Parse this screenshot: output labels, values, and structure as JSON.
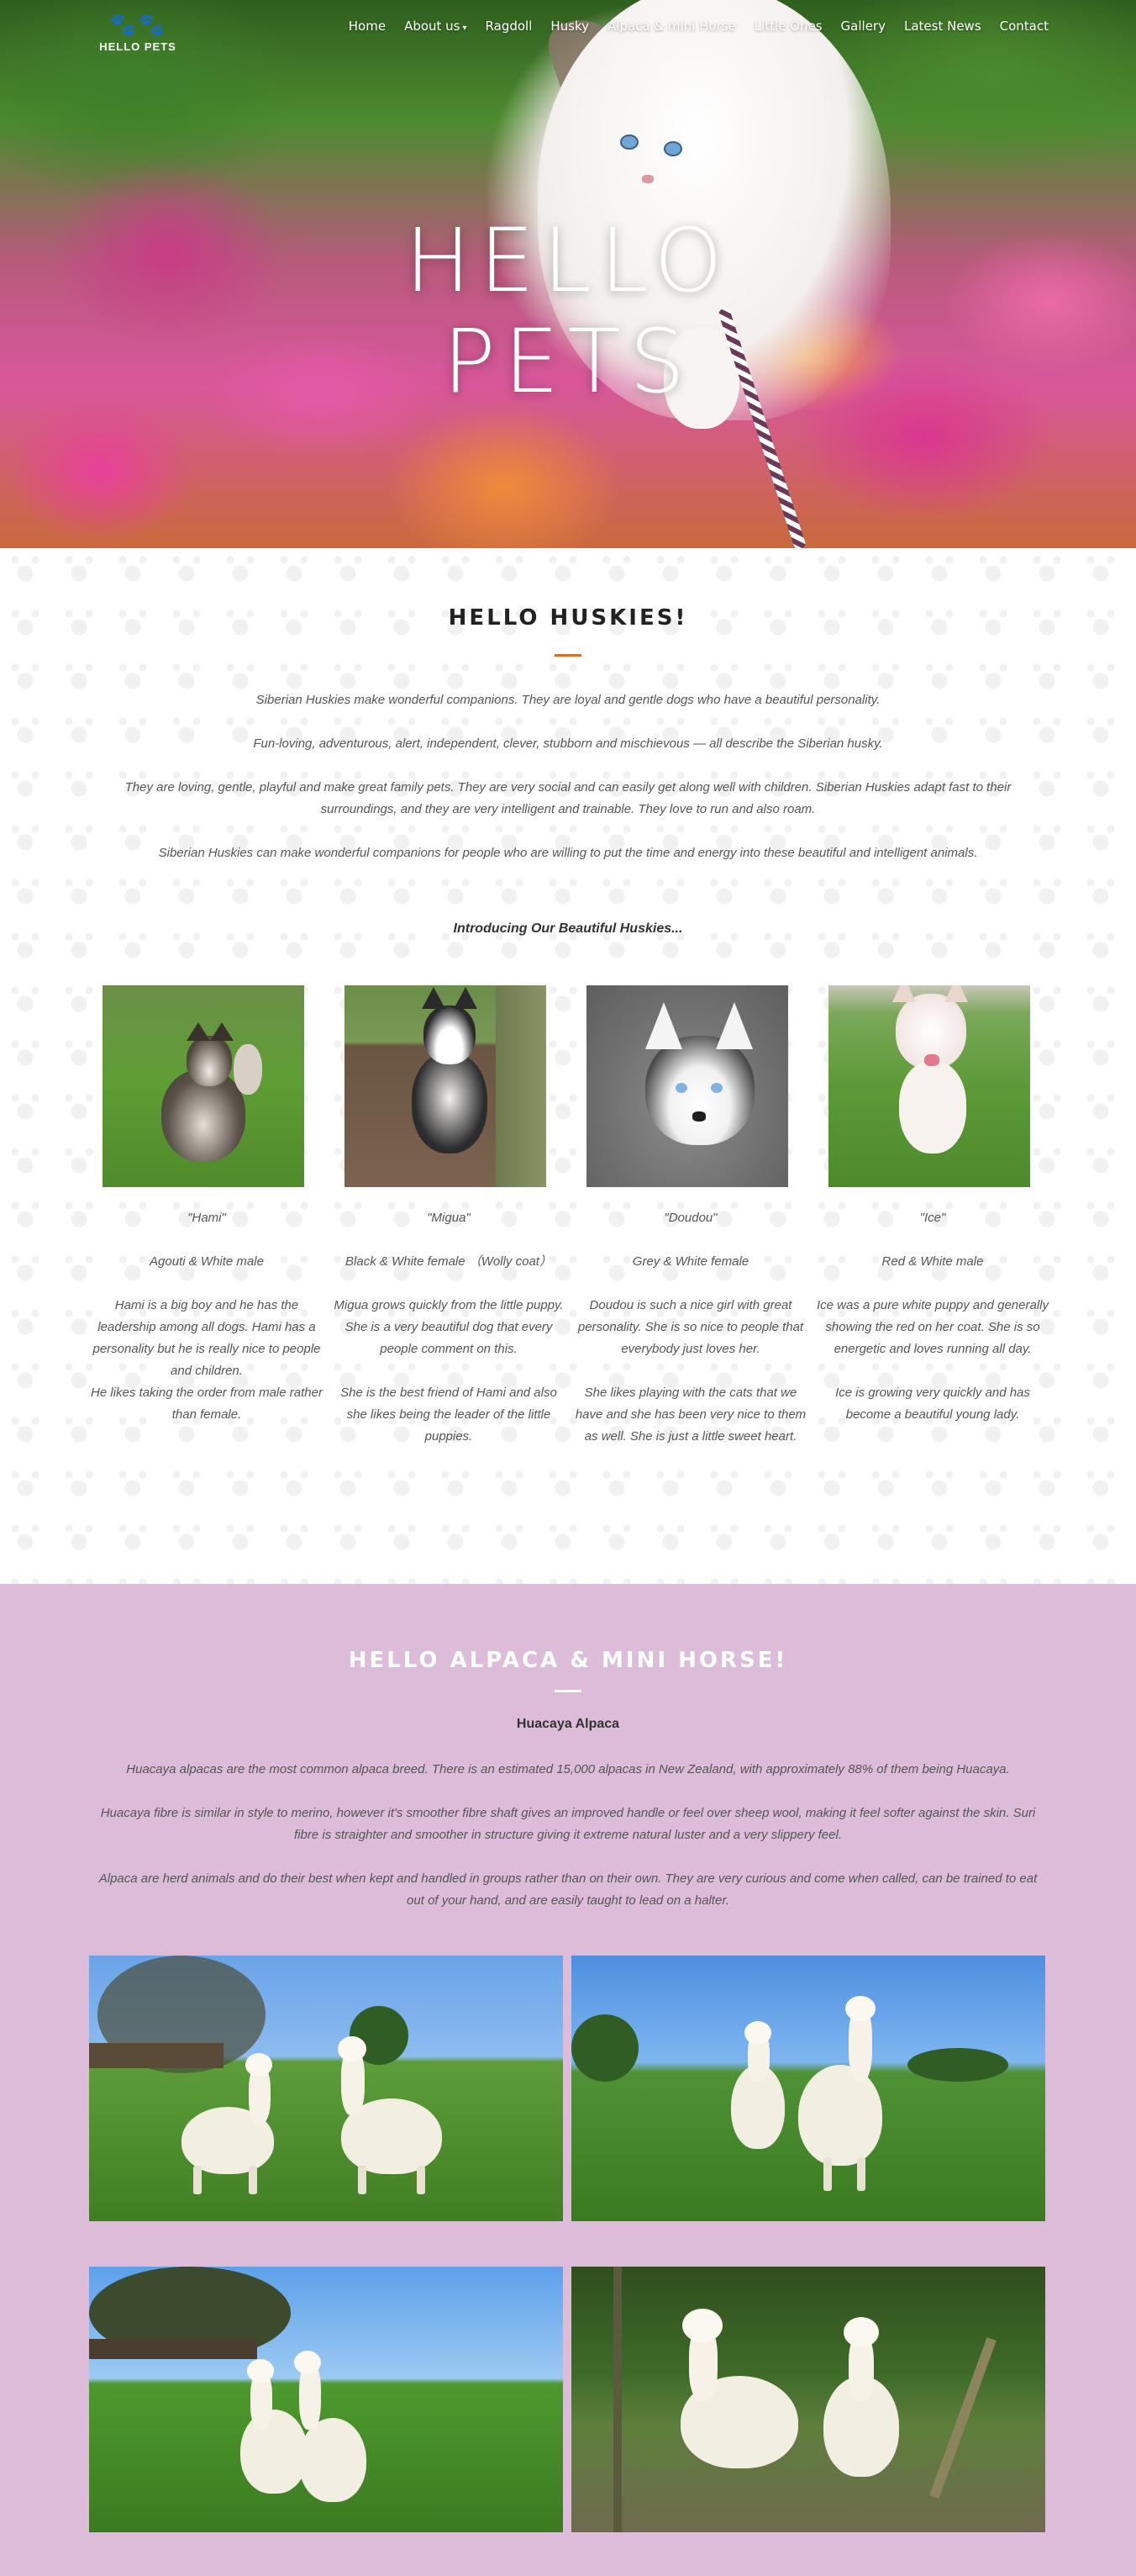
{
  "nav": {
    "logo_text": "HELLO PETS",
    "items": [
      {
        "label": "Home"
      },
      {
        "label": "About us"
      },
      {
        "label": "Ragdoll"
      },
      {
        "label": "Husky"
      },
      {
        "label": "Alpaca & mini Horse"
      },
      {
        "label": "Little Ones"
      },
      {
        "label": "Gallery"
      },
      {
        "label": "Latest News"
      },
      {
        "label": "Contact"
      }
    ]
  },
  "hero": {
    "title_line1": "HELLO",
    "title_line2": "PETS"
  },
  "huskies": {
    "title": "HELLO HUSKIES!",
    "paragraphs": [
      "Siberian Huskies make wonderful companions. They are loyal and gentle dogs who have a beautiful personality.",
      "Fun-loving, adventurous, alert, independent, clever, stubborn and mischievous — all describe the Siberian husky.",
      "They are loving, gentle, playful and make great family pets. They are very social and can easily get along well with children. Siberian Huskies adapt fast to their surroundings, and they are very intelligent and trainable. They love to run and also roam.",
      "Siberian Huskies can make wonderful companions for people who are willing to put the time and energy into these beautiful and intelligent animals."
    ],
    "intro": "Introducing Our Beautiful Huskies...",
    "dogs": [
      {
        "name": "\"Hami\"",
        "color": "Agouti & White male",
        "desc1": "Hami is a big boy and he has the leadership among all dogs. Hami has a personality but he is really nice to people and children.",
        "desc2": "He likes taking the order from male rather than female."
      },
      {
        "name": "\"Migua\"",
        "color": "Black & White female （Wolly coat）",
        "desc1": "Migua grows quickly from the little puppy. She is a very beautiful dog that every people comment on this.",
        "desc2": "She is the best friend of Hami and also she likes being the leader of the little puppies."
      },
      {
        "name": "\"Doudou\"",
        "color": "Grey & White female",
        "desc1": "Doudou is such a nice girl with great personality. She is so nice to people that everybody just loves her.",
        "desc2": "She likes playing with the cats that we have and she has been very nice to them as well.  She is just a little sweet heart."
      },
      {
        "name": "\"Ice\"",
        "color": "Red & White male",
        "desc1": "Ice was a pure white puppy and generally showing the red on her coat. She is so energetic and loves running all day.",
        "desc2": "Ice is growing very quickly and has become a beautiful young lady."
      }
    ]
  },
  "alpaca": {
    "title": "HELLO ALPACA & MINI HORSE!",
    "subtitle": "Huacaya Alpaca",
    "paragraphs": [
      "Huacaya alpacas are the most common alpaca breed. There is an estimated 15,000 alpacas in New Zealand, with approximately 88% of them being Huacaya.",
      "Huacaya fibre is similar in style to merino, however it's smoother fibre shaft gives an improved handle or feel over sheep wool, making it feel softer against the skin.  Suri fibre is straighter and smoother in structure giving it extreme natural luster and a very slippery feel.",
      "Alpaca are herd animals and do their best when kept and handled in groups rather than on their own.  They are very curious and come when called, can be trained to eat out of your hand, and are easily taught to lead on a halter."
    ]
  },
  "colors": {
    "accent_orange": "#e06a2c",
    "alpaca_bg": "#dcbcd8",
    "text": "#555555"
  }
}
